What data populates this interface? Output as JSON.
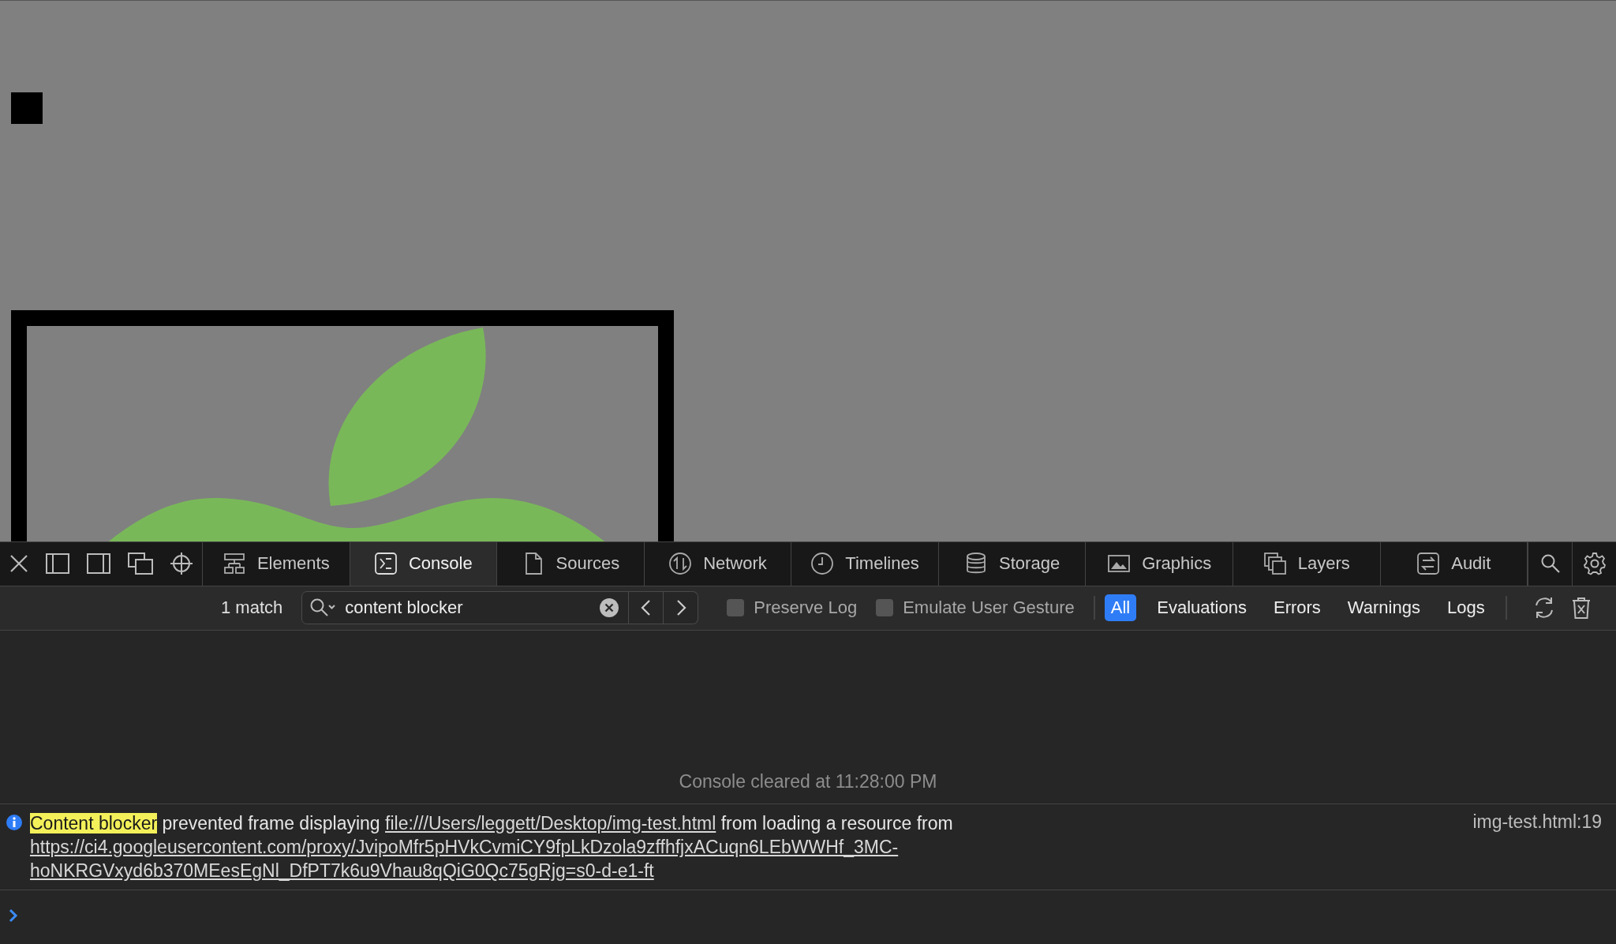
{
  "tab_bar": {
    "tabs": [
      {
        "label": "Elements",
        "kind": "elements",
        "selected": false
      },
      {
        "label": "Console",
        "kind": "console",
        "selected": true
      },
      {
        "label": "Sources",
        "kind": "sources",
        "selected": false
      },
      {
        "label": "Network",
        "kind": "network",
        "selected": false
      },
      {
        "label": "Timelines",
        "kind": "timelines",
        "selected": false
      },
      {
        "label": "Storage",
        "kind": "storage",
        "selected": false
      },
      {
        "label": "Graphics",
        "kind": "graphics",
        "selected": false
      },
      {
        "label": "Layers",
        "kind": "layers",
        "selected": false
      },
      {
        "label": "Audit",
        "kind": "audit",
        "selected": false
      }
    ]
  },
  "filter_bar": {
    "match_count": "1 match",
    "search": {
      "value": "content blocker"
    },
    "checkboxes": [
      {
        "label": "Preserve Log",
        "checked": false
      },
      {
        "label": "Emulate User Gesture",
        "checked": false
      }
    ],
    "levels": [
      {
        "label": "All",
        "selected": true
      },
      {
        "label": "Evaluations",
        "selected": false
      },
      {
        "label": "Errors",
        "selected": false
      },
      {
        "label": "Warnings",
        "selected": false
      },
      {
        "label": "Logs",
        "selected": false
      }
    ]
  },
  "console": {
    "cleared_notice": "Console cleared at 11:28:00 PM",
    "messages": [
      {
        "kind": "info",
        "location": "img-test.html:19",
        "parts": [
          {
            "kind": "highlight",
            "text": "Content blocker"
          },
          {
            "kind": "plain",
            "text": " prevented frame displaying "
          },
          {
            "kind": "link",
            "text": "file:///Users/leggett/Desktop/img-test.html"
          },
          {
            "kind": "plain",
            "text": " from loading a resource from "
          },
          {
            "kind": "link",
            "text": "https://ci4.googleusercontent.com/proxy/JvipoMfr5pHVkCvmiCY9fpLkDzola9zffhfjxACuqn6LEbWWHf_3MC-"
          },
          {
            "kind": "link",
            "text": "hoNKRGVxyd6b370MEesEgNl_DfPT7k6u9Vhau8qQiG0Qc75gRjg=s0-d-e1-ft"
          }
        ]
      }
    ]
  }
}
